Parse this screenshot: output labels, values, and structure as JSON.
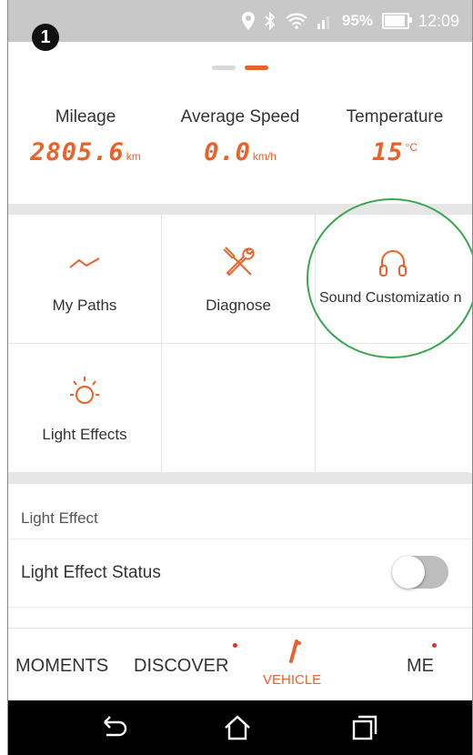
{
  "status_bar": {
    "step_number": "1",
    "battery_percent": "95%",
    "time": "12:09",
    "icons": [
      "location-icon",
      "bluetooth-icon",
      "wifi-icon",
      "signal-icon",
      "battery-icon"
    ]
  },
  "pager": {
    "pages": 2,
    "active_page": 2
  },
  "stats": {
    "mileage": {
      "label": "Mileage",
      "value": "2805.6",
      "unit": "km"
    },
    "avg_speed": {
      "label": "Average Speed",
      "value": "0.0",
      "unit": "km/h"
    },
    "temperature": {
      "label": "Temperature",
      "value": "15",
      "unit": "°C"
    }
  },
  "features": {
    "my_paths": {
      "label": "My Paths",
      "icon": "path-icon"
    },
    "diagnose": {
      "label": "Diagnose",
      "icon": "tools-icon"
    },
    "sound": {
      "label": "Sound Customizatio n",
      "icon": "headphones-icon"
    },
    "light_effects": {
      "label": "Light Effects",
      "icon": "light-bulb-icon"
    }
  },
  "light_effect_section": {
    "header": "Light Effect",
    "status_label": "Light Effect Status",
    "status_on": false
  },
  "bottom_nav": {
    "moments": "MOMENTS",
    "discover": "DISCOVER",
    "vehicle": "VEHICLE",
    "me": "ME"
  },
  "colors": {
    "accent": "#e8622a",
    "highlight": "#3aa650",
    "notification": "#e03030"
  }
}
